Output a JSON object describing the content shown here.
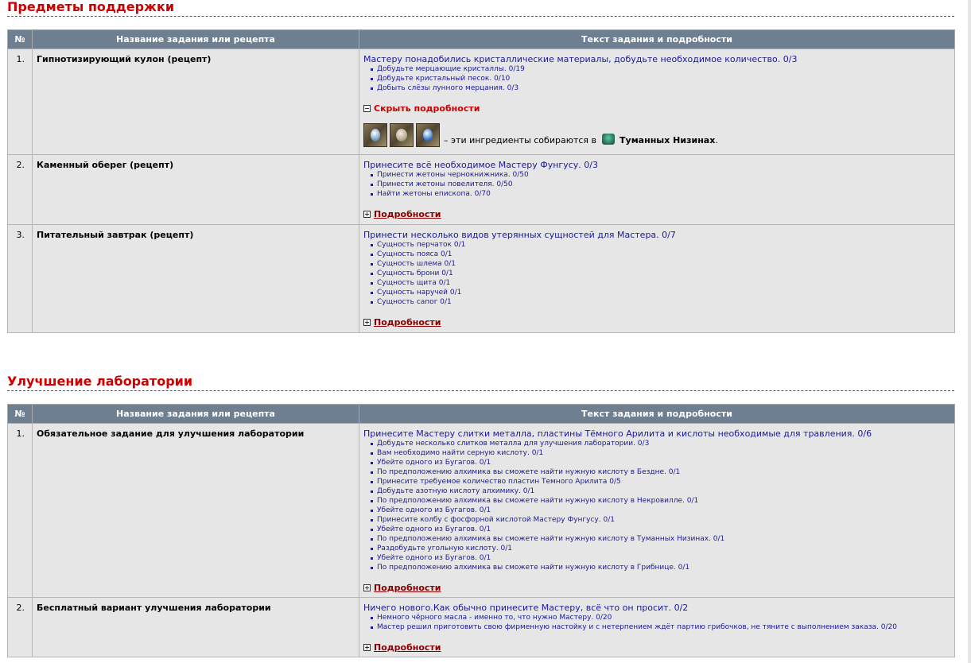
{
  "sections": [
    {
      "title": "Предметы поддержки",
      "headers": {
        "num": "№",
        "name": "Название задания или рецепта",
        "text": "Текст задания и подробности"
      },
      "rows": [
        {
          "num": "1.",
          "name": "Гипнотизирующий кулон (рецепт)",
          "main": "Мастеру понадобились кристаллические материалы, добудьте необходимое количество. 0/3",
          "objectives": [
            "Добудьте мерцающие кристаллы. 0/19",
            "Добудьте кристальный песок. 0/10",
            "Добыть слёзы лунного мерцания. 0/3"
          ],
          "toggle": "Скрыть подробности",
          "ingredients_text": "– эти ингредиенты собираются в",
          "ingredients_place": "Туманных Низинах",
          "ingredients_end": "."
        },
        {
          "num": "2.",
          "name": "Каменный оберег (рецепт)",
          "main": "Принесите всё необходимое Мастеру Фунгусу. 0/3",
          "objectives": [
            "Принести жетоны чернокнижника. 0/50",
            "Принести жетоны повелителя. 0/50",
            "Найти жетоны епископа. 0/70"
          ],
          "toggle": "Подробности"
        },
        {
          "num": "3.",
          "name": "Питательный завтрак (рецепт)",
          "main": "Принести несколько видов утерянных сущностей для Мастера. 0/7",
          "objectives": [
            "Сущность перчаток 0/1",
            "Сущность пояса 0/1",
            "Сущность шлема 0/1",
            "Сущность брони 0/1",
            "Сущность щита 0/1",
            "Сущность наручей 0/1",
            "Сущность сапог 0/1"
          ],
          "toggle": "Подробности"
        }
      ]
    },
    {
      "title": "Улучшение лаборатории",
      "headers": {
        "num": "№",
        "name": "Название задания или рецепта",
        "text": "Текст задания и подробности"
      },
      "rows": [
        {
          "num": "1.",
          "name": "Обязательное задание для улучшения лаборатории",
          "main": "Принесите Мастеру слитки металла, пластины Тёмного Арилита и кислоты необходимые для травления. 0/6",
          "objectives": [
            "Добудьте несколько слитков металла для улучшения лаборатории. 0/3",
            "Вам необходимо найти серную кислоту. 0/1",
            "Убейте одного из Бугагов. 0/1",
            "По предположению алхимика вы сможете найти нужную кислоту в Бездне. 0/1",
            "Принесите требуемое количество пластин Темного Арилита 0/5",
            "Добудьте азотную кислоту алхимику. 0/1",
            "По предположению алхимика вы сможете найти нужную кислоту в Некровилле. 0/1",
            "Убейте одного из Бугагов. 0/1",
            "Принесите колбу с фосфорной кислотой Мастеру Фунгусу. 0/1",
            "Убейте одного из Бугагов. 0/1",
            "По предположению алхимика вы сможете найти нужную кислоту в Туманных Низинах. 0/1",
            "Раздобудьте угольную кислоту. 0/1",
            "Убейте одного из Бугагов. 0/1",
            "По предположению алхимика вы сможете найти нужную кислоту в Грибнице. 0/1"
          ],
          "toggle": "Подробности"
        },
        {
          "num": "2.",
          "name": "Бесплатный вариант улучшения лаборатории",
          "main": "Ничего нового.Как обычно принесите Мастеру, всё что он просит. 0/2",
          "objectives": [
            "Немного чёрного масла - именно то, что нужно Мастеру. 0/20",
            "Мастер решил приготовить свою фирменную настойку и с нетерпением ждёт партию грибочков, не тяните с выполнением заказа. 0/20"
          ],
          "toggle": "Подробности"
        }
      ]
    }
  ]
}
